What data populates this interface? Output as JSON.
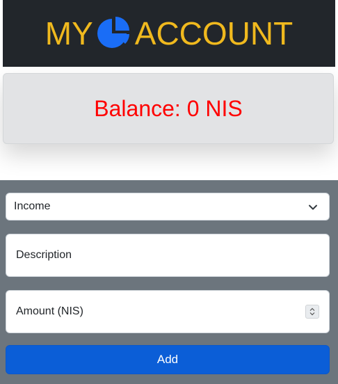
{
  "header": {
    "logo_left": "MY",
    "logo_right": "ACCOUNT",
    "logo_color": "#f0b91e",
    "background": "#22262b"
  },
  "balance": {
    "label": "Balance:",
    "amount": "0",
    "currency": "NIS",
    "text_color": "#ff0000"
  },
  "form": {
    "type_select": {
      "selected": "Income"
    },
    "description": {
      "placeholder": "Description"
    },
    "amount": {
      "placeholder": "Amount (NIS)"
    },
    "add_label": "Add",
    "accent": "#0b5ed7"
  }
}
